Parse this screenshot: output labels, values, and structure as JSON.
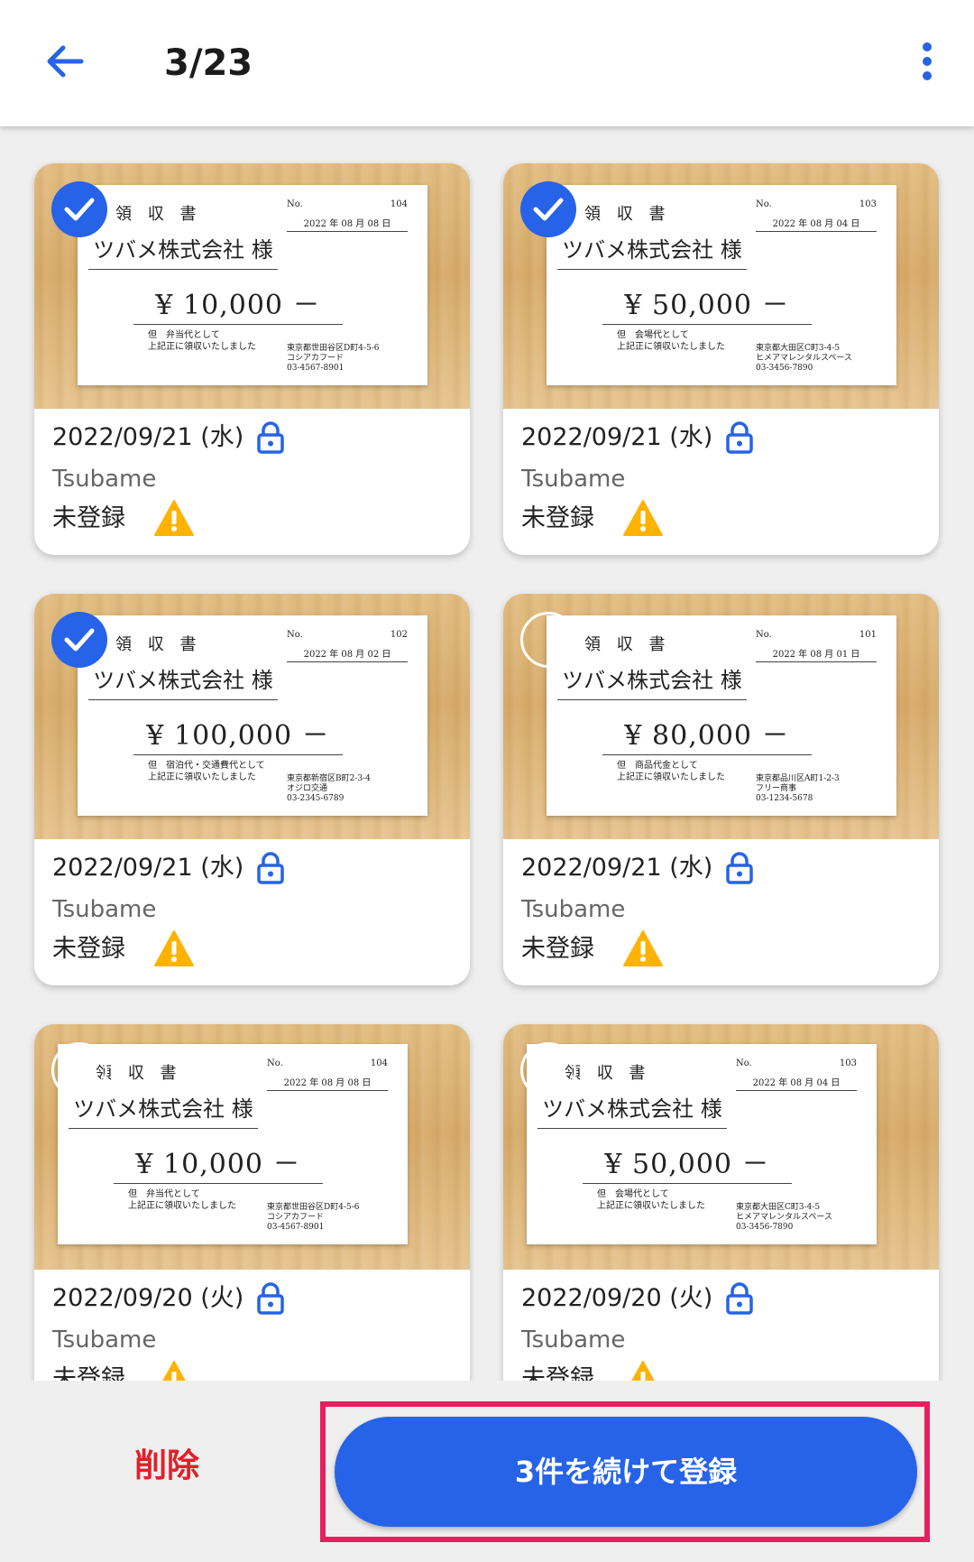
{
  "header": {
    "title": "3/23"
  },
  "cards": [
    {
      "selected": true,
      "date": "2022/09/21 (水)",
      "company": "Tsubame",
      "status": "未登録",
      "receipt": {
        "title": "領 収 書",
        "no_label": "No.",
        "no": "104",
        "date": "2022 年 08 月 08 日",
        "to": "ツバメ株式会社 様",
        "amount": "¥ 10,000 －",
        "note": "但　弁当代として",
        "note2": "上記正に領収いたしました",
        "addr": "東京都世田谷区D町4-5-6\nコシアカフード\n03-4567-8901"
      }
    },
    {
      "selected": true,
      "date": "2022/09/21 (水)",
      "company": "Tsubame",
      "status": "未登録",
      "receipt": {
        "title": "領 収 書",
        "no_label": "No.",
        "no": "103",
        "date": "2022 年 08 月 04 日",
        "to": "ツバメ株式会社 様",
        "amount": "¥ 50,000 －",
        "note": "但　会場代として",
        "note2": "上記正に領収いたしました",
        "addr": "東京都大田区C町3-4-5\nヒメアマレンタルスペース\n03-3456-7890"
      }
    },
    {
      "selected": true,
      "date": "2022/09/21 (水)",
      "company": "Tsubame",
      "status": "未登録",
      "receipt": {
        "title": "領 収 書",
        "no_label": "No.",
        "no": "102",
        "date": "2022 年 08 月 02 日",
        "to": "ツバメ株式会社 様",
        "amount": "¥ 100,000 －",
        "note": "但　宿泊代・交通費代として",
        "note2": "上記正に領収いたしました",
        "addr": "東京都新宿区B町2-3-4\nオジロ交通\n03-2345-6789"
      }
    },
    {
      "selected": false,
      "date": "2022/09/21 (水)",
      "company": "Tsubame",
      "status": "未登録",
      "receipt": {
        "title": "領 収 書",
        "no_label": "No.",
        "no": "101",
        "date": "2022 年 08 月 01 日",
        "to": "ツバメ株式会社 様",
        "amount": "¥ 80,000 －",
        "note": "但　商品代金として",
        "note2": "上記正に領収いたしました",
        "addr": "東京都品川区A町1-2-3\nフリー商事\n03-1234-5678"
      }
    },
    {
      "selected": false,
      "date": "2022/09/20 (火)",
      "company": "Tsubame",
      "status": "未登録",
      "receipt": {
        "title": "領 収 書",
        "no_label": "No.",
        "no": "104",
        "date": "2022 年 08 月 08 日",
        "to": "ツバメ株式会社 様",
        "amount": "¥ 10,000 －",
        "note": "但　弁当代として",
        "note2": "上記正に領収いたしました",
        "addr": "東京都世田谷区D町4-5-6\nコシアカフード\n03-4567-8901"
      }
    },
    {
      "selected": false,
      "date": "2022/09/20 (火)",
      "company": "Tsubame",
      "status": "未登録",
      "receipt": {
        "title": "領 収 書",
        "no_label": "No.",
        "no": "103",
        "date": "2022 年 08 月 04 日",
        "to": "ツバメ株式会社 様",
        "amount": "¥ 50,000 －",
        "note": "但　会場代として",
        "note2": "上記正に領収いたしました",
        "addr": "東京都大田区C町3-4-5\nヒメアマレンタルスペース\n03-3456-7890"
      }
    }
  ],
  "footer": {
    "delete_label": "削除",
    "register_label": "3件を続けて登録"
  },
  "colors": {
    "accent": "#2663e8",
    "warning": "#ffb300",
    "danger": "#e0202a",
    "highlight": "#e81f5e"
  },
  "icons": {
    "back": "arrow-left-icon",
    "more": "more-vert-icon",
    "check": "check-circle-icon",
    "lock": "lock-icon",
    "warning": "warning-triangle-icon"
  }
}
